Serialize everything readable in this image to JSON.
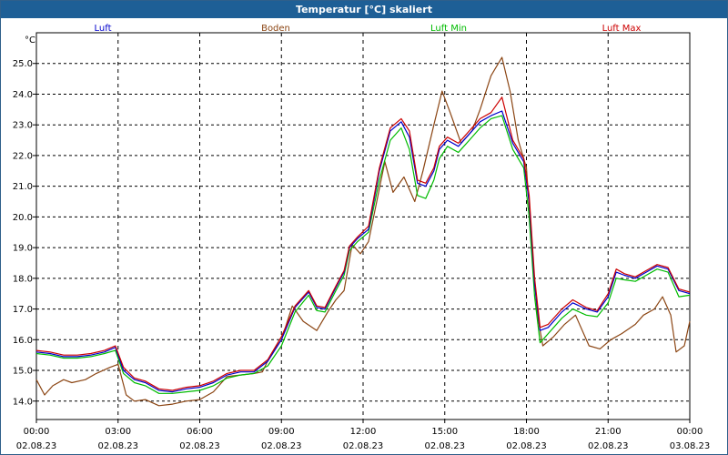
{
  "window": {
    "title": "Temperatur [°C] skaliert"
  },
  "chart_data": {
    "type": "line",
    "title": "Temperatur [°C] skaliert",
    "ylabel": "°C",
    "ylim": [
      13.4,
      26.0
    ],
    "xlim": [
      0,
      24
    ],
    "y_ticks": [
      "14.0",
      "15.0",
      "16.0",
      "17.0",
      "18.0",
      "19.0",
      "20.0",
      "21.0",
      "22.0",
      "23.0",
      "24.0",
      "25.0"
    ],
    "x_ticks": [
      {
        "time": "00:00",
        "date": "02.08.23"
      },
      {
        "time": "03:00",
        "date": "02.08.23"
      },
      {
        "time": "06:00",
        "date": "02.08.23"
      },
      {
        "time": "09:00",
        "date": "02.08.23"
      },
      {
        "time": "12:00",
        "date": "02.08.23"
      },
      {
        "time": "15:00",
        "date": "02.08.23"
      },
      {
        "time": "18:00",
        "date": "02.08.23"
      },
      {
        "time": "21:00",
        "date": "02.08.23"
      },
      {
        "time": "00:00",
        "date": "03.08.23"
      }
    ],
    "grid": true,
    "legend_position": "top",
    "series": [
      {
        "name": "Luft",
        "color": "#0000cc",
        "points": [
          [
            0,
            15.6
          ],
          [
            0.5,
            15.55
          ],
          [
            1.0,
            15.45
          ],
          [
            1.5,
            15.45
          ],
          [
            2.0,
            15.5
          ],
          [
            2.5,
            15.6
          ],
          [
            2.9,
            15.75
          ],
          [
            3.2,
            15.0
          ],
          [
            3.6,
            14.7
          ],
          [
            4.0,
            14.6
          ],
          [
            4.5,
            14.35
          ],
          [
            5.0,
            14.3
          ],
          [
            5.5,
            14.4
          ],
          [
            6.0,
            14.45
          ],
          [
            6.5,
            14.6
          ],
          [
            7.0,
            14.85
          ],
          [
            7.5,
            14.95
          ],
          [
            8.0,
            14.95
          ],
          [
            8.5,
            15.3
          ],
          [
            9.0,
            16.0
          ],
          [
            9.5,
            17.05
          ],
          [
            10.0,
            17.55
          ],
          [
            10.3,
            17.05
          ],
          [
            10.6,
            17.0
          ],
          [
            11.0,
            17.7
          ],
          [
            11.3,
            18.2
          ],
          [
            11.5,
            19.0
          ],
          [
            11.8,
            19.3
          ],
          [
            12.2,
            19.6
          ],
          [
            12.6,
            21.5
          ],
          [
            13.0,
            22.8
          ],
          [
            13.4,
            23.1
          ],
          [
            13.7,
            22.6
          ],
          [
            14.0,
            21.1
          ],
          [
            14.3,
            21.0
          ],
          [
            14.6,
            21.5
          ],
          [
            14.8,
            22.2
          ],
          [
            15.1,
            22.5
          ],
          [
            15.5,
            22.3
          ],
          [
            15.9,
            22.7
          ],
          [
            16.3,
            23.1
          ],
          [
            16.7,
            23.3
          ],
          [
            17.1,
            23.45
          ],
          [
            17.5,
            22.4
          ],
          [
            17.9,
            21.8
          ],
          [
            18.1,
            20.5
          ],
          [
            18.3,
            17.8
          ],
          [
            18.5,
            16.3
          ],
          [
            18.8,
            16.4
          ],
          [
            19.3,
            16.9
          ],
          [
            19.7,
            17.2
          ],
          [
            20.2,
            17.0
          ],
          [
            20.6,
            16.9
          ],
          [
            21.0,
            17.4
          ],
          [
            21.3,
            18.2
          ],
          [
            21.6,
            18.1
          ],
          [
            22.0,
            18.0
          ],
          [
            22.4,
            18.2
          ],
          [
            22.8,
            18.4
          ],
          [
            23.2,
            18.3
          ],
          [
            23.6,
            17.6
          ],
          [
            24.0,
            17.5
          ]
        ]
      },
      {
        "name": "Boden",
        "color": "#8b4513",
        "points": [
          [
            0,
            14.7
          ],
          [
            0.3,
            14.2
          ],
          [
            0.6,
            14.5
          ],
          [
            1.0,
            14.7
          ],
          [
            1.3,
            14.6
          ],
          [
            1.8,
            14.7
          ],
          [
            2.2,
            14.9
          ],
          [
            2.7,
            15.1
          ],
          [
            3.0,
            15.2
          ],
          [
            3.3,
            14.2
          ],
          [
            3.6,
            14.0
          ],
          [
            4.0,
            14.05
          ],
          [
            4.5,
            13.85
          ],
          [
            5.0,
            13.9
          ],
          [
            5.5,
            14.0
          ],
          [
            6.0,
            14.05
          ],
          [
            6.5,
            14.3
          ],
          [
            7.0,
            14.8
          ],
          [
            7.5,
            14.85
          ],
          [
            8.0,
            14.9
          ],
          [
            8.3,
            14.95
          ],
          [
            8.6,
            15.5
          ],
          [
            9.0,
            16.0
          ],
          [
            9.4,
            17.1
          ],
          [
            9.8,
            16.6
          ],
          [
            10.3,
            16.3
          ],
          [
            10.7,
            16.9
          ],
          [
            11.0,
            17.3
          ],
          [
            11.3,
            17.6
          ],
          [
            11.6,
            19.1
          ],
          [
            11.9,
            18.8
          ],
          [
            12.2,
            19.2
          ],
          [
            12.5,
            20.5
          ],
          [
            12.8,
            21.8
          ],
          [
            13.1,
            20.8
          ],
          [
            13.5,
            21.3
          ],
          [
            13.9,
            20.5
          ],
          [
            14.2,
            21.5
          ],
          [
            14.6,
            23.0
          ],
          [
            14.9,
            24.1
          ],
          [
            15.2,
            23.4
          ],
          [
            15.6,
            22.4
          ],
          [
            16.0,
            22.8
          ],
          [
            16.3,
            23.5
          ],
          [
            16.7,
            24.6
          ],
          [
            17.1,
            25.2
          ],
          [
            17.4,
            24.1
          ],
          [
            17.7,
            22.5
          ],
          [
            18.0,
            21.6
          ],
          [
            18.2,
            19.0
          ],
          [
            18.4,
            16.8
          ],
          [
            18.6,
            15.8
          ],
          [
            19.0,
            16.1
          ],
          [
            19.4,
            16.5
          ],
          [
            19.8,
            16.8
          ],
          [
            20.3,
            15.8
          ],
          [
            20.7,
            15.7
          ],
          [
            21.1,
            16.0
          ],
          [
            21.5,
            16.2
          ],
          [
            22.0,
            16.5
          ],
          [
            22.3,
            16.8
          ],
          [
            22.7,
            17.0
          ],
          [
            23.0,
            17.4
          ],
          [
            23.3,
            16.8
          ],
          [
            23.5,
            15.6
          ],
          [
            23.8,
            15.8
          ],
          [
            24.0,
            16.6
          ]
        ]
      },
      {
        "name": "Luft Min",
        "color": "#00bb00",
        "points": [
          [
            0,
            15.55
          ],
          [
            0.5,
            15.5
          ],
          [
            1.0,
            15.4
          ],
          [
            1.5,
            15.4
          ],
          [
            2.0,
            15.45
          ],
          [
            2.5,
            15.55
          ],
          [
            2.9,
            15.65
          ],
          [
            3.2,
            14.9
          ],
          [
            3.6,
            14.6
          ],
          [
            4.0,
            14.5
          ],
          [
            4.5,
            14.25
          ],
          [
            5.0,
            14.25
          ],
          [
            5.5,
            14.3
          ],
          [
            6.0,
            14.35
          ],
          [
            6.5,
            14.5
          ],
          [
            7.0,
            14.75
          ],
          [
            7.5,
            14.85
          ],
          [
            8.0,
            14.9
          ],
          [
            8.5,
            15.15
          ],
          [
            9.0,
            15.8
          ],
          [
            9.5,
            16.9
          ],
          [
            10.0,
            17.45
          ],
          [
            10.3,
            16.95
          ],
          [
            10.6,
            16.9
          ],
          [
            11.0,
            17.6
          ],
          [
            11.3,
            18.1
          ],
          [
            11.5,
            18.9
          ],
          [
            11.8,
            19.2
          ],
          [
            12.2,
            19.5
          ],
          [
            12.6,
            21.2
          ],
          [
            13.0,
            22.5
          ],
          [
            13.4,
            22.9
          ],
          [
            13.7,
            22.2
          ],
          [
            14.0,
            20.7
          ],
          [
            14.3,
            20.6
          ],
          [
            14.6,
            21.2
          ],
          [
            14.8,
            21.9
          ],
          [
            15.1,
            22.3
          ],
          [
            15.5,
            22.1
          ],
          [
            15.9,
            22.5
          ],
          [
            16.3,
            22.9
          ],
          [
            16.7,
            23.2
          ],
          [
            17.1,
            23.3
          ],
          [
            17.5,
            22.2
          ],
          [
            17.9,
            21.6
          ],
          [
            18.1,
            20.0
          ],
          [
            18.3,
            17.4
          ],
          [
            18.5,
            15.9
          ],
          [
            18.8,
            16.2
          ],
          [
            19.3,
            16.7
          ],
          [
            19.7,
            17.0
          ],
          [
            20.2,
            16.8
          ],
          [
            20.6,
            16.75
          ],
          [
            21.0,
            17.2
          ],
          [
            21.3,
            18.0
          ],
          [
            21.6,
            17.95
          ],
          [
            22.0,
            17.9
          ],
          [
            22.4,
            18.1
          ],
          [
            22.8,
            18.3
          ],
          [
            23.2,
            18.2
          ],
          [
            23.6,
            17.4
          ],
          [
            24.0,
            17.45
          ]
        ]
      },
      {
        "name": "Luft Max",
        "color": "#cc0000",
        "points": [
          [
            0,
            15.65
          ],
          [
            0.5,
            15.6
          ],
          [
            1.0,
            15.5
          ],
          [
            1.5,
            15.5
          ],
          [
            2.0,
            15.55
          ],
          [
            2.5,
            15.65
          ],
          [
            2.9,
            15.8
          ],
          [
            3.2,
            15.1
          ],
          [
            3.6,
            14.75
          ],
          [
            4.0,
            14.65
          ],
          [
            4.5,
            14.4
          ],
          [
            5.0,
            14.35
          ],
          [
            5.5,
            14.45
          ],
          [
            6.0,
            14.5
          ],
          [
            6.5,
            14.65
          ],
          [
            7.0,
            14.9
          ],
          [
            7.5,
            15.0
          ],
          [
            8.0,
            15.0
          ],
          [
            8.5,
            15.35
          ],
          [
            9.0,
            16.1
          ],
          [
            9.5,
            17.1
          ],
          [
            10.0,
            17.6
          ],
          [
            10.3,
            17.1
          ],
          [
            10.6,
            17.05
          ],
          [
            11.0,
            17.75
          ],
          [
            11.3,
            18.25
          ],
          [
            11.5,
            19.05
          ],
          [
            11.8,
            19.35
          ],
          [
            12.2,
            19.7
          ],
          [
            12.6,
            21.6
          ],
          [
            13.0,
            22.9
          ],
          [
            13.4,
            23.2
          ],
          [
            13.7,
            22.8
          ],
          [
            14.0,
            21.2
          ],
          [
            14.3,
            21.1
          ],
          [
            14.6,
            21.6
          ],
          [
            14.8,
            22.3
          ],
          [
            15.1,
            22.6
          ],
          [
            15.5,
            22.4
          ],
          [
            15.9,
            22.8
          ],
          [
            16.3,
            23.2
          ],
          [
            16.7,
            23.4
          ],
          [
            17.1,
            23.9
          ],
          [
            17.5,
            22.5
          ],
          [
            17.9,
            21.9
          ],
          [
            18.1,
            20.7
          ],
          [
            18.3,
            18.0
          ],
          [
            18.5,
            16.4
          ],
          [
            18.8,
            16.5
          ],
          [
            19.3,
            17.0
          ],
          [
            19.7,
            17.3
          ],
          [
            20.2,
            17.05
          ],
          [
            20.6,
            16.95
          ],
          [
            21.0,
            17.5
          ],
          [
            21.3,
            18.3
          ],
          [
            21.6,
            18.15
          ],
          [
            22.0,
            18.05
          ],
          [
            22.4,
            18.25
          ],
          [
            22.8,
            18.45
          ],
          [
            23.2,
            18.35
          ],
          [
            23.6,
            17.65
          ],
          [
            24.0,
            17.55
          ]
        ]
      }
    ]
  }
}
